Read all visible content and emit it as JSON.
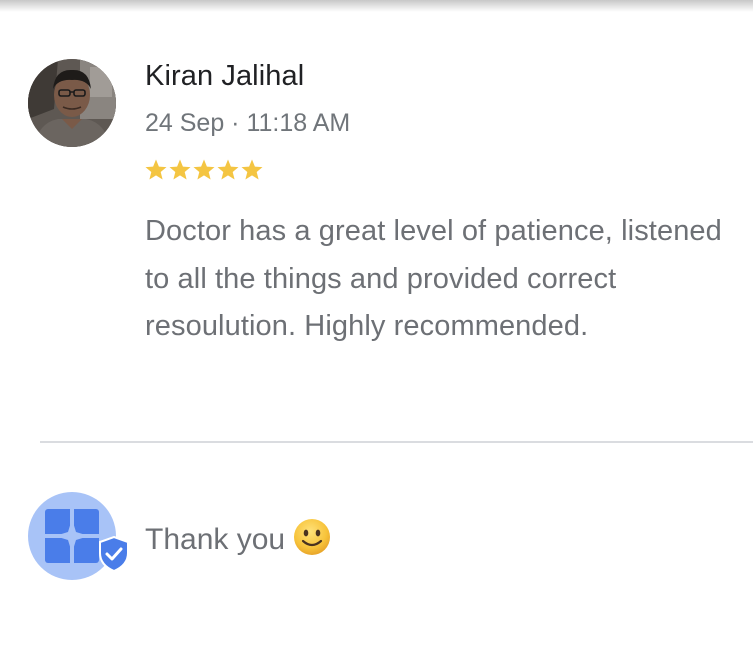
{
  "review": {
    "reviewer_name": "Kiran Jalihal",
    "timestamp": "24 Sep · 11:18 AM",
    "rating": 5,
    "rating_max": 5,
    "star_color": "#f4c542",
    "text": "Doctor has a great level of patience, listened to all the things and provided correct resoulution. Highly recommended.",
    "avatar_icon": "user-photo"
  },
  "owner_response": {
    "text": "Thank you",
    "emoji_icon": "slightly-smiling-face",
    "avatar_icon": "business-logo",
    "badge_icon": "verified-shield-check",
    "accent_color": "#4a7de9"
  }
}
